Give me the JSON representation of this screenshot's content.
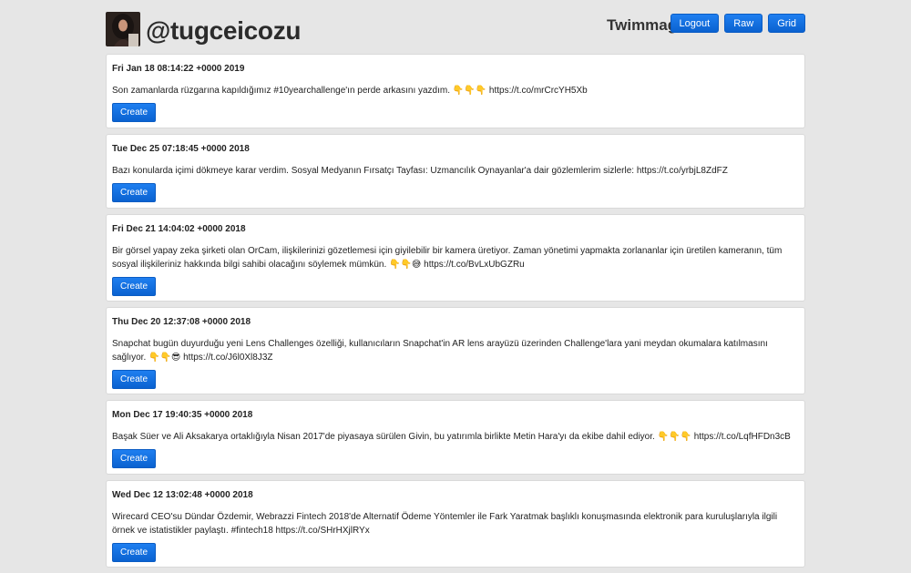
{
  "header": {
    "username": "@tugceicozu",
    "brand": "Twimmage",
    "buttons": [
      "Logout",
      "Raw",
      "Grid"
    ]
  },
  "posts": [
    {
      "date": "Fri Jan 18 08:14:22 +0000 2019",
      "text": "Son zamanlarda rüzgarına kapıldığımız #10yearchallenge'ın perde arkasını yazdım. 👇👇👇 https://t.co/mrCrcYH5Xb",
      "button": "Create"
    },
    {
      "date": "Tue Dec 25 07:18:45 +0000 2018",
      "text": "Bazı konularda içimi dökmeye karar verdim. Sosyal Medyanın Fırsatçı Tayfası: Uzmancılık Oynayanlar'a dair gözlemlerim sizlerle: https://t.co/yrbjL8ZdFZ",
      "button": "Create"
    },
    {
      "date": "Fri Dec 21 14:04:02 +0000 2018",
      "text": "Bir görsel yapay zeka şirketi olan OrCam, ilişkilerinizi gözetlemesi için giyilebilir bir kamera üretiyor. Zaman yönetimi yapmakta zorlananlar için üretilen kameranın, tüm sosyal ilişkileriniz hakkında bilgi sahibi olacağını söylemek mümkün. 👇👇😅 https://t.co/BvLxUbGZRu",
      "button": "Create"
    },
    {
      "date": "Thu Dec 20 12:37:08 +0000 2018",
      "text": "Snapchat bugün duyurduğu yeni Lens Challenges özelliği, kullanıcıların Snapchat'in AR lens arayüzü üzerinden Challenge'lara yani meydan okumalara katılmasını sağlıyor. 👇👇😎 https://t.co/J6l0Xl8J3Z",
      "button": "Create"
    },
    {
      "date": "Mon Dec 17 19:40:35 +0000 2018",
      "text": "Başak Süer ve Ali Aksakarya ortaklığıyla Nisan 2017'de piyasaya sürülen Givin, bu yatırımla birlikte Metin Hara'yı da ekibe dahil ediyor. 👇👇👇 https://t.co/LqfHFDn3cB",
      "button": "Create"
    },
    {
      "date": "Wed Dec 12 13:02:48 +0000 2018",
      "text": "Wirecard CEO'su Dündar Özdemir, Webrazzi Fintech 2018'de Alternatif Ödeme Yöntemler ile Fark Yaratmak başlıklı konuşmasında elektronik para kuruluşlarıyla ilgili örnek ve istatistikler paylaştı. #fintech18 https://t.co/SHrHXjlRYx",
      "button": "Create"
    }
  ]
}
